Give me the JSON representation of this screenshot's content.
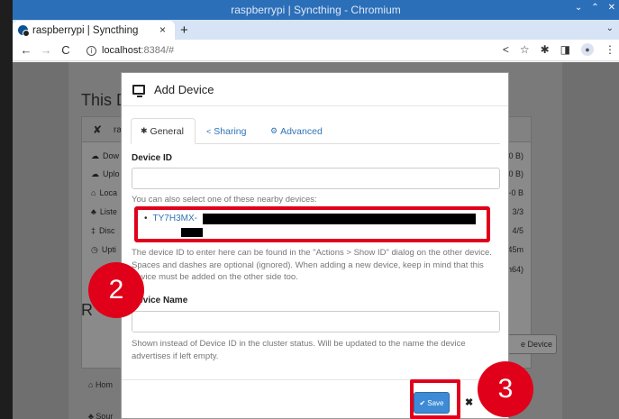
{
  "window": {
    "title": "raspberrypi | Syncthing - Chromium"
  },
  "browser": {
    "tab_title": "raspberrypi | Syncthing",
    "url_host": "localhost",
    "url_path": ":8384/#"
  },
  "background": {
    "this_device_heading": "This D",
    "device_name_short": "ra",
    "stats": [
      {
        "label": "Dow",
        "value": "3/s (0 B)"
      },
      {
        "label": "Uplo",
        "value": "3/s (0 B)"
      },
      {
        "label": "Loca",
        "value": "~0 B"
      },
      {
        "label": "Liste",
        "value": "3/3"
      },
      {
        "label": "Disc",
        "value": "4/5"
      },
      {
        "label": "Upti",
        "value": "45m"
      },
      {
        "label": "",
        "value": "Arch64)"
      }
    ],
    "remote_heading": "R",
    "add_remote_button": "e Device",
    "footer_links": [
      "Hom",
      "Sour"
    ]
  },
  "dialog": {
    "title": "Add Device",
    "tabs": [
      {
        "icon": "✱",
        "label": "General",
        "active": true
      },
      {
        "icon": "<",
        "label": "Sharing",
        "active": false
      },
      {
        "icon": "⚙",
        "label": "Advanced",
        "active": false
      }
    ],
    "device_id_label": "Device ID",
    "device_id_value": "",
    "nearby_text": "You can also select one of these nearby devices:",
    "nearby_device_id": "TY7H3MX-",
    "device_id_help": "The device ID to enter here can be found in the \"Actions > Show ID\" dialog on the other device. Spaces and dashes are optional (ignored). When adding a new device, keep in mind that this device must be added on the other side too.",
    "device_name_label": "Device Name",
    "device_name_value": "",
    "device_name_help": "Shown instead of Device ID in the cluster status. Will be updated to the name the device advertises if left empty.",
    "save_label": "Save",
    "close_label": "✖"
  },
  "annotations": {
    "step2": "2",
    "step3": "3",
    "highlight_color": "#e0001b"
  }
}
